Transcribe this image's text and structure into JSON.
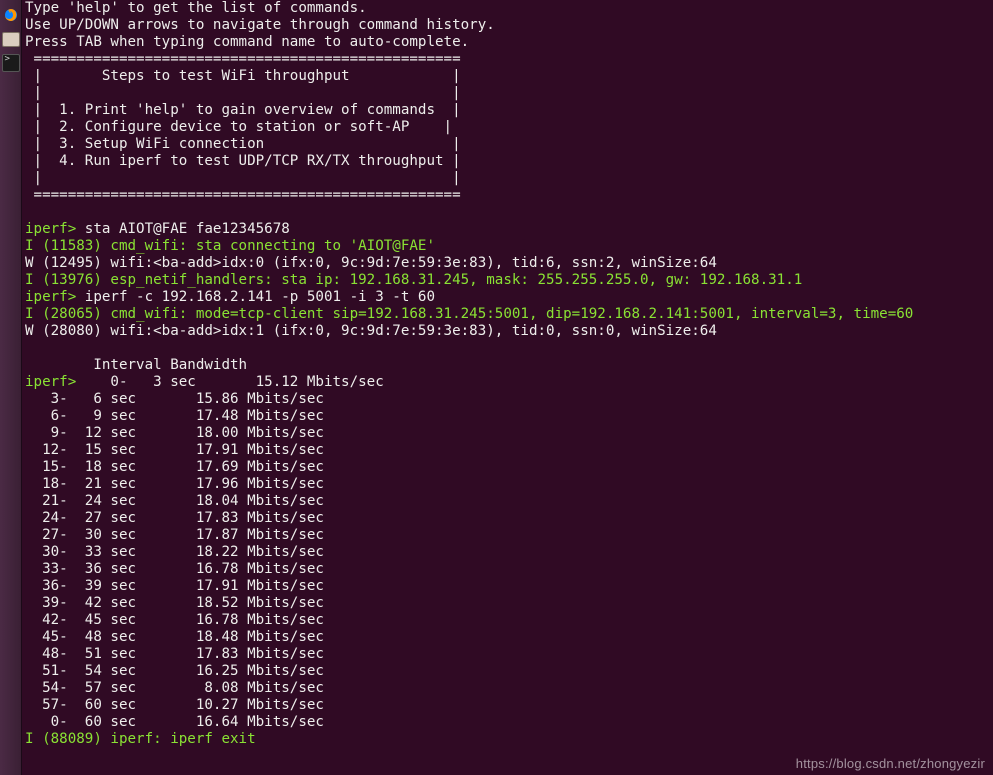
{
  "launcher": {
    "items": [
      {
        "name": "firefox-icon"
      },
      {
        "name": "files-icon"
      },
      {
        "name": "terminal-icon"
      }
    ]
  },
  "terminal": {
    "intro": [
      "Type 'help' to get the list of commands.",
      "Use UP/DOWN arrows to navigate through command history.",
      "Press TAB when typing command name to auto-complete."
    ],
    "banner": [
      " ==================================================",
      " |       Steps to test WiFi throughput            |",
      " |                                                |",
      " |  1. Print 'help' to gain overview of commands  |",
      " |  2. Configure device to station or soft-AP    |",
      " |  3. Setup WiFi connection                      |",
      " |  4. Run iperf to test UDP/TCP RX/TX throughput |",
      " |                                                |",
      " =================================================="
    ],
    "prompt1": "iperf> ",
    "cmd1": "sta AIOT@FAE fae12345678",
    "log1": "I (11583) cmd_wifi: sta connecting to 'AIOT@FAE'",
    "log2": "W (12495) wifi:<ba-add>idx:0 (ifx:0, 9c:9d:7e:59:3e:83), tid:6, ssn:2, winSize:64",
    "log3": "I (13976) esp_netif_handlers: sta ip: 192.168.31.245, mask: 255.255.255.0, gw: 192.168.31.1",
    "prompt2": "iperf> ",
    "cmd2": "iperf -c 192.168.2.141 -p 5001 -i 3 -t 60",
    "log4": "I (28065) cmd_wifi: mode=tcp-client sip=192.168.31.245:5001, dip=192.168.2.141:5001, interval=3, time=60",
    "log5": "W (28080) wifi:<ba-add>idx:1 (ifx:0, 9c:9d:7e:59:3e:83), tid:0, ssn:0, winSize:64",
    "header": "        Interval Bandwidth",
    "prompt3": "iperf> ",
    "first_row_tail": "   0-   3 sec       15.12 Mbits/sec",
    "rows": [
      "   3-   6 sec       15.86 Mbits/sec",
      "   6-   9 sec       17.48 Mbits/sec",
      "   9-  12 sec       18.00 Mbits/sec",
      "  12-  15 sec       17.91 Mbits/sec",
      "  15-  18 sec       17.69 Mbits/sec",
      "  18-  21 sec       17.96 Mbits/sec",
      "  21-  24 sec       18.04 Mbits/sec",
      "  24-  27 sec       17.83 Mbits/sec",
      "  27-  30 sec       17.87 Mbits/sec",
      "  30-  33 sec       18.22 Mbits/sec",
      "  33-  36 sec       16.78 Mbits/sec",
      "  36-  39 sec       17.91 Mbits/sec",
      "  39-  42 sec       18.52 Mbits/sec",
      "  42-  45 sec       16.78 Mbits/sec",
      "  45-  48 sec       18.48 Mbits/sec",
      "  48-  51 sec       17.83 Mbits/sec",
      "  51-  54 sec       16.25 Mbits/sec",
      "  54-  57 sec        8.08 Mbits/sec",
      "  57-  60 sec       10.27 Mbits/sec",
      "   0-  60 sec       16.64 Mbits/sec"
    ],
    "exit_log": "I (88089) iperf: iperf exit"
  },
  "watermark": "https://blog.csdn.net/zhongyezir"
}
